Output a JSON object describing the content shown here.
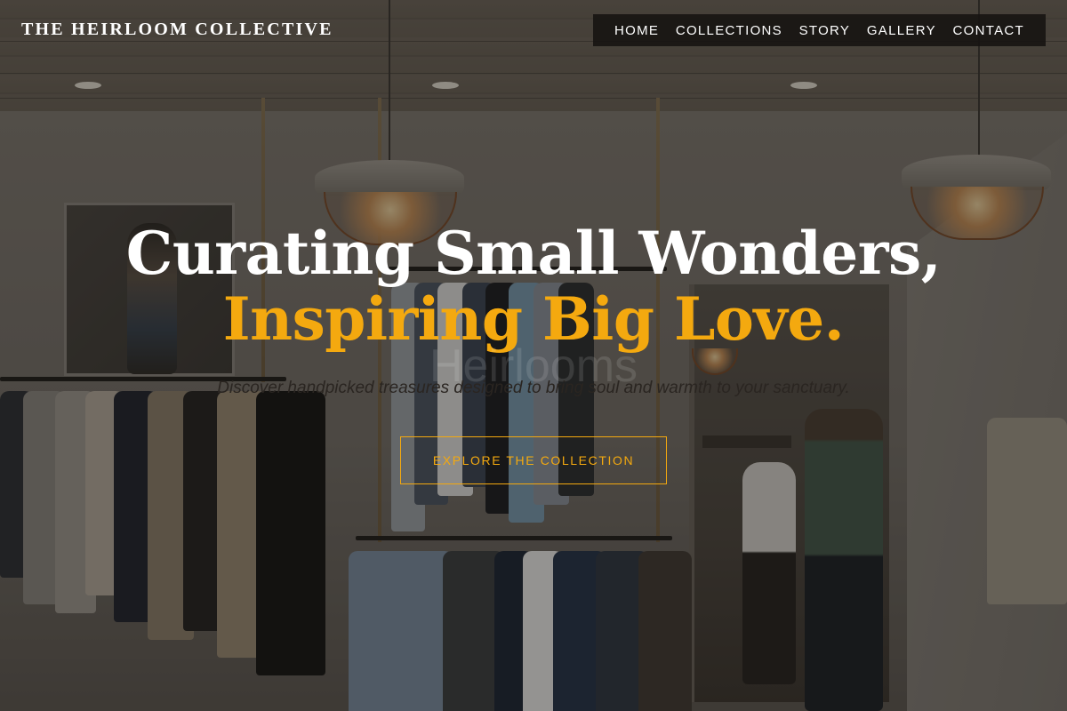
{
  "brand": {
    "name": "THE HEIRLOOM COLLECTIVE"
  },
  "nav": {
    "items": [
      {
        "label": "HOME"
      },
      {
        "label": "COLLECTIONS"
      },
      {
        "label": "STORY"
      },
      {
        "label": "GALLERY"
      },
      {
        "label": "CONTACT"
      }
    ]
  },
  "hero": {
    "title_line_1": "Curating Small Wonders,",
    "title_line_2": "Inspiring Big Love.",
    "ghost_text": "Heirlooms",
    "subtitle": "Discover handpicked treasures designed to bring soul and warmth to your sanctuary.",
    "cta_label": "EXPLORE THE COLLECTION"
  },
  "colors": {
    "accent": "#f4a90f",
    "text_light": "#ffffff",
    "nav_background": "#161412"
  }
}
